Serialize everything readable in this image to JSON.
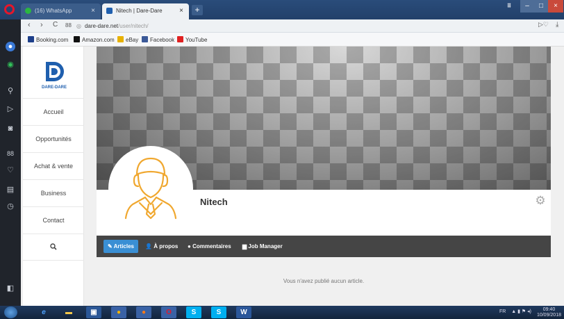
{
  "browser": {
    "tabs": [
      {
        "title": "(16) WhatsApp",
        "close": "×"
      },
      {
        "title": "Nitech | Dare-Dare",
        "close": "×"
      }
    ],
    "new_tab": "+",
    "window_controls": {
      "minimize": "–",
      "maximize": "□",
      "close": "×"
    },
    "nav": {
      "back": "‹",
      "forward": "›",
      "reload": "C",
      "grid": "88"
    },
    "address": {
      "host": "dare-dare.net",
      "path": "/user/nitech/"
    },
    "bookmarks": [
      {
        "label": "Booking.com",
        "icon": "booking-icon",
        "color": "#1e3f8a"
      },
      {
        "label": "Amazon.com",
        "icon": "amazon-icon",
        "color": "#111111"
      },
      {
        "label": "eBay",
        "icon": "ebay-icon",
        "color": "#e8b100"
      },
      {
        "label": "Facebook",
        "icon": "facebook-icon",
        "color": "#3b5998"
      },
      {
        "label": "YouTube",
        "icon": "youtube-icon",
        "color": "#e02121"
      }
    ]
  },
  "site": {
    "logo_text": "DARE-DARE",
    "nav": [
      "Accueil",
      "Opportunités",
      "Achat & vente",
      "Business",
      "Contact"
    ],
    "search_icon": "search-icon",
    "profile_name": "Nitech",
    "tabs": [
      {
        "label": "Articles",
        "icon": "pencil-icon",
        "active": true
      },
      {
        "label": "À propos",
        "icon": "user-icon",
        "active": false
      },
      {
        "label": "Commentaires",
        "icon": "comment-icon",
        "active": false
      },
      {
        "label": "Job Manager",
        "icon": "briefcase-icon",
        "active": false
      }
    ],
    "empty_message": "Vous n'avez publié aucun article.",
    "accent": "#3a8fd4",
    "avatar_color": "#f0a830"
  },
  "taskbar": {
    "lang": "FR",
    "time": "09:40",
    "date": "10/09/2018"
  }
}
